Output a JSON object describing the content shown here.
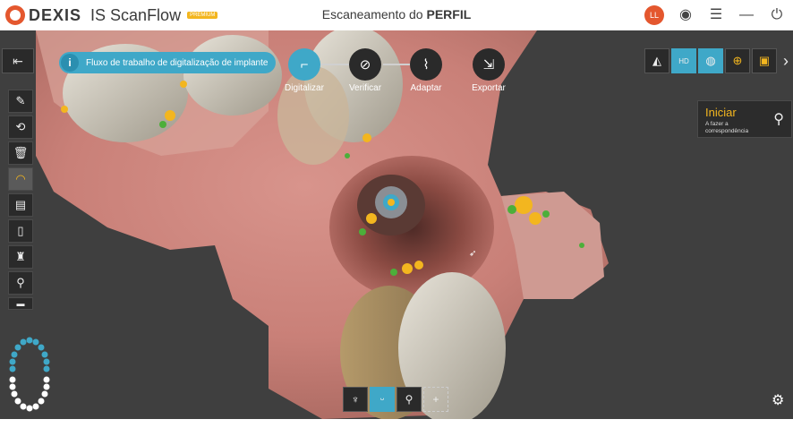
{
  "app": {
    "brand": "DEXIS",
    "product": "IS ScanFlow",
    "badge": "PREMIUM",
    "title_prefix": "Escaneamento do",
    "title_bold": "PERFIL",
    "user_initials": "LL"
  },
  "header_icons": [
    "record-icon",
    "menu-icon",
    "minimize-icon",
    "power-icon"
  ],
  "info_banner": {
    "icon": "i",
    "text": "Fluxo de trabalho de digitalização de implante"
  },
  "workflow_steps": [
    {
      "label": "Digitalizar",
      "icon": "scanner-icon",
      "active": true
    },
    {
      "label": "Verificar",
      "icon": "inspect-icon",
      "active": false
    },
    {
      "label": "Adaptar",
      "icon": "adapt-icon",
      "active": false
    },
    {
      "label": "Exportar",
      "icon": "export-icon",
      "active": false
    }
  ],
  "left_tools": [
    "exit-icon",
    "brush-icon",
    "restore-icon",
    "trash-icon",
    "arch-icon",
    "save-icon",
    "document-icon",
    "tooth-ruler-icon",
    "implant-pair-icon",
    "scan-body-icon"
  ],
  "right_tools": [
    {
      "name": "tooth-view-icon",
      "glyph": "◭",
      "active": false
    },
    {
      "name": "hd-icon",
      "glyph": "HD",
      "active": true
    },
    {
      "name": "color-wheel-icon",
      "glyph": "◍",
      "active": true
    },
    {
      "name": "zoom-icon",
      "glyph": "⊕",
      "active": false
    },
    {
      "name": "snapshot-icon",
      "glyph": "▣",
      "active": false
    },
    {
      "name": "chevron-right-icon",
      "glyph": "›",
      "active": false
    }
  ],
  "start_panel": {
    "title": "Iniciar",
    "subtitle": "A fazer a correspondência"
  },
  "bottom_tools": [
    {
      "name": "upper-jaw-icon",
      "glyph": "♆",
      "active": false
    },
    {
      "name": "lower-jaw-icon",
      "glyph": "ᵕ",
      "active": true
    },
    {
      "name": "implant-icon",
      "glyph": "⚲",
      "active": false
    },
    {
      "name": "add-icon",
      "glyph": "+",
      "active": false,
      "dashed": true
    }
  ],
  "colors": {
    "accent": "#3fa8c8",
    "highlight": "#f3b61f",
    "brand": "#e4572e",
    "viewport_bg": "#3f3f3f"
  }
}
